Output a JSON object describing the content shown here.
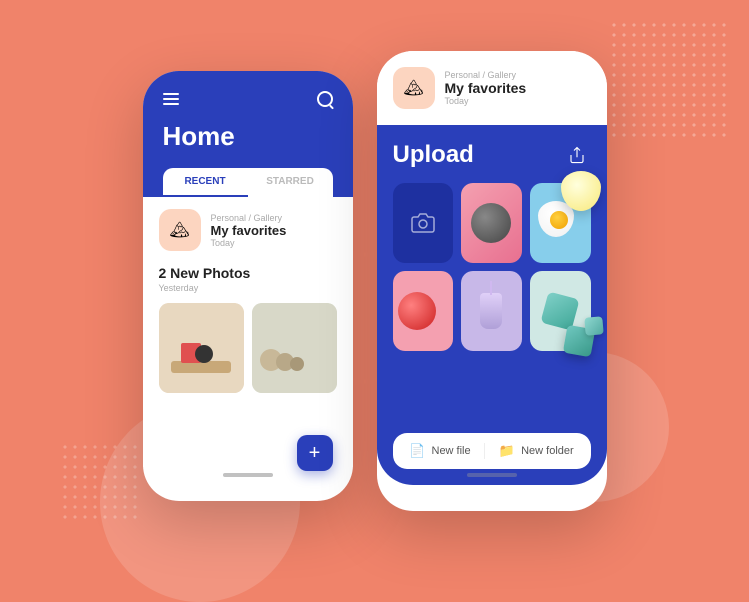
{
  "background": {
    "color": "#f0836a"
  },
  "phone_home": {
    "header": {
      "title": "Home",
      "hamburger_label": "menu",
      "search_label": "search"
    },
    "tabs": [
      {
        "label": "RECENT",
        "active": true
      },
      {
        "label": "STARRED",
        "active": false
      }
    ],
    "file_item": {
      "path": "Personal / Gallery",
      "name": "My favorites",
      "date": "Today"
    },
    "section": {
      "title": "2 New Photos",
      "subtitle": "Yesterday"
    },
    "fab_label": "+"
  },
  "phone_upload": {
    "top_file": {
      "path": "Personal / Gallery",
      "name": "My favorites",
      "date": "Today"
    },
    "upload_section": {
      "title": "Upload",
      "share_label": "share"
    },
    "grid": [
      {
        "type": "camera",
        "label": "camera"
      },
      {
        "type": "pink_ball",
        "label": "pink ball photo"
      },
      {
        "type": "egg",
        "label": "egg photo"
      },
      {
        "type": "red_ball",
        "label": "red ball photo"
      },
      {
        "type": "shake",
        "label": "shake photo"
      },
      {
        "type": "teal",
        "label": "teal boxes photo"
      }
    ],
    "bottom_buttons": [
      {
        "label": "New file",
        "icon": "file-icon"
      },
      {
        "label": "New folder",
        "icon": "folder-icon"
      }
    ]
  }
}
